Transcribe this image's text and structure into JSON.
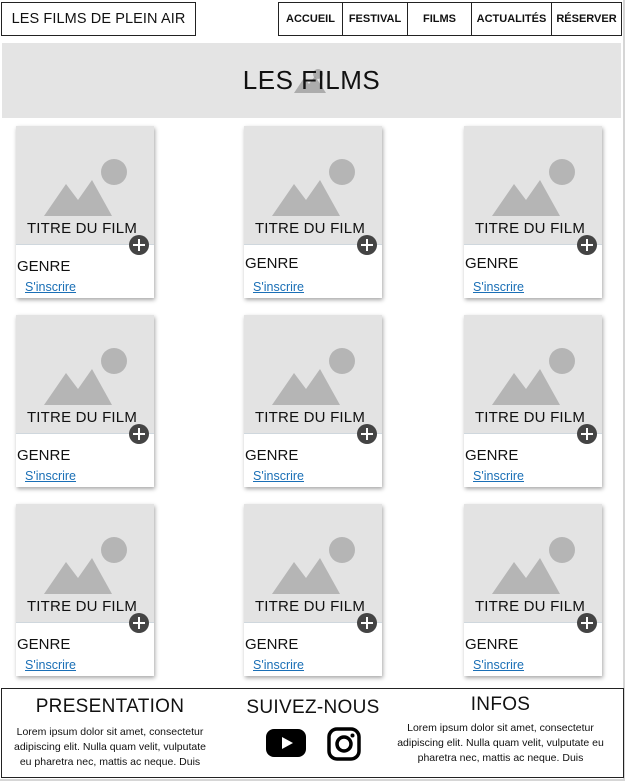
{
  "header": {
    "logo": "LES FILMS DE PLEIN AIR",
    "nav": [
      "ACCUEIL",
      "FESTIVAL",
      "FILMS",
      "ACTUALITÉS",
      "RÉSERVER"
    ]
  },
  "hero": {
    "title": "LES FILMS",
    "icon": "image-placeholder-icon"
  },
  "cards": [
    {
      "title": "TITRE DU FILM",
      "genre": "GENRE",
      "link": "S'inscrire"
    },
    {
      "title": "TITRE DU FILM",
      "genre": "GENRE",
      "link": "S'inscrire"
    },
    {
      "title": "TITRE DU FILM",
      "genre": "GENRE",
      "link": "S'inscrire"
    },
    {
      "title": "TITRE DU FILM",
      "genre": "GENRE",
      "link": "S'inscrire"
    },
    {
      "title": "TITRE DU FILM",
      "genre": "GENRE",
      "link": "S'inscrire"
    },
    {
      "title": "TITRE DU FILM",
      "genre": "GENRE",
      "link": "S'inscrire"
    },
    {
      "title": "TITRE DU FILM",
      "genre": "GENRE",
      "link": "S'inscrire"
    },
    {
      "title": "TITRE DU FILM",
      "genre": "GENRE",
      "link": "S'inscrire"
    },
    {
      "title": "TITRE DU FILM",
      "genre": "GENRE",
      "link": "S'inscrire"
    }
  ],
  "card_icons": {
    "image": "image-placeholder-icon",
    "add": "plus-circle-icon"
  },
  "footer": {
    "presentation": {
      "title": "PRESENTATION",
      "text": "Lorem ipsum dolor sit amet, consectetur adipiscing elit. Nulla quam velit, vulputate eu pharetra nec, mattis ac neque. Duis"
    },
    "social": {
      "title": "SUIVEZ-NOUS",
      "icons": [
        "youtube-icon",
        "instagram-icon"
      ]
    },
    "infos": {
      "title": "INFOS",
      "text": "Lorem ipsum dolor sit amet, consectetur adipiscing elit. Nulla quam velit, vulputate eu pharetra nec, mattis ac neque. Duis"
    }
  },
  "colors": {
    "link": "#1a6fb6",
    "placeholder_bg": "#e3e3e3",
    "placeholder_icon": "#b5b5b5",
    "hero_bg": "#e4e4e4"
  }
}
